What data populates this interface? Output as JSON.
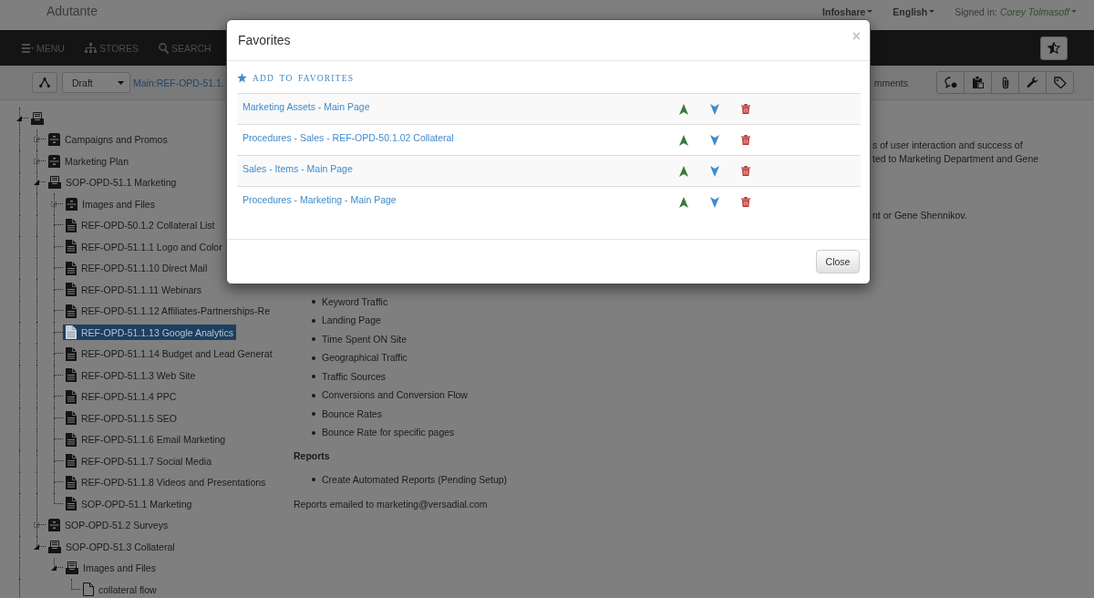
{
  "header": {
    "brand": "Adutante",
    "dropdowns": [
      {
        "label": "Infoshare"
      },
      {
        "label": "English"
      }
    ],
    "signed_in_label": "Signed in:",
    "user_name": "Corey Tolmasoff"
  },
  "navbar": {
    "items": [
      {
        "label": "MENU"
      },
      {
        "label": "STORES"
      },
      {
        "label": "SEARCH"
      }
    ]
  },
  "toolbar": {
    "status_select": "Draft",
    "page_link": "Main:REF-OPD-51.1.",
    "comments_link": "mments"
  },
  "tree": [
    {
      "kind": "folder",
      "expanded": true,
      "selected": false,
      "children": [
        {
          "label": "Campaigns and Promos",
          "kind": "folder",
          "expanded": false,
          "selected": false
        },
        {
          "label": "Marketing Plan",
          "kind": "folder",
          "expanded": false,
          "selected": false
        },
        {
          "label": "SOP-OPD-51.1 Marketing",
          "kind": "folder",
          "expanded": true,
          "selected": false,
          "children": [
            {
              "label": "Images and Files",
              "kind": "folder",
              "expanded": false,
              "selected": false
            },
            {
              "label": "REF-OPD-50.1.2 Collateral List",
              "kind": "page",
              "selected": false
            },
            {
              "label": "REF-OPD-51.1.1 Logo and Color",
              "kind": "page",
              "selected": false
            },
            {
              "label": "REF-OPD-51.1.10 Direct Mail",
              "kind": "page",
              "selected": false
            },
            {
              "label": "REF-OPD-51.1.11 Webinars",
              "kind": "page",
              "selected": false
            },
            {
              "label": "REF-OPD-51.1.12 Affiliates-Partnerships-Re",
              "kind": "page",
              "selected": false
            },
            {
              "label": "REF-OPD-51.1.13 Google Analytics",
              "kind": "page",
              "selected": true
            },
            {
              "label": "REF-OPD-51.1.14 Budget and Lead Generat",
              "kind": "page",
              "selected": false
            },
            {
              "label": "REF-OPD-51.1.3 Web Site",
              "kind": "page",
              "selected": false
            },
            {
              "label": "REF-OPD-51.1.4 PPC",
              "kind": "page",
              "selected": false
            },
            {
              "label": "REF-OPD-51.1.5 SEO",
              "kind": "page",
              "selected": false
            },
            {
              "label": "REF-OPD-51.1.6 Email Marketing",
              "kind": "page",
              "selected": false
            },
            {
              "label": "REF-OPD-51.1.7 Social Media",
              "kind": "page",
              "selected": false
            },
            {
              "label": "REF-OPD-51.1.8 Videos and Presentations",
              "kind": "page",
              "selected": false
            },
            {
              "label": "SOP-OPD-51.1 Marketing",
              "kind": "page",
              "selected": false
            }
          ]
        },
        {
          "label": "SOP-OPD-51.2 Surveys",
          "kind": "folder",
          "expanded": false,
          "selected": false
        },
        {
          "label": "SOP-OPD-51.3 Collateral",
          "kind": "folder",
          "expanded": true,
          "selected": false,
          "children": [
            {
              "label": "Images and Files",
              "kind": "folder",
              "expanded": true,
              "selected": false,
              "children": [
                {
                  "label": "collateral flow",
                  "kind": "file",
                  "selected": false
                }
              ]
            }
          ]
        }
      ]
    }
  ],
  "content": {
    "paragraphs": [
      {
        "lines": [
          "s of user interaction and success of",
          "ted to Marketing Department and Gene"
        ]
      },
      {
        "lines": [
          "nt or Gene Shennikov."
        ]
      }
    ],
    "metrics": [
      "Keyword Traffic",
      "Landing Page",
      "Time Spent ON Site",
      "Geographical Traffic",
      "Traffic Sources",
      "Conversions and Conversion Flow",
      "Bounce Rates",
      "Bounce Rate for specific pages"
    ],
    "reports_heading": "Reports",
    "reports_items": [
      "Create Automated Reports (Pending Setup)"
    ],
    "note": "Reports emailed to marketing@versadial.com"
  },
  "modal": {
    "title": "Favorites",
    "close_symbol": "×",
    "add_link": "ADD TO FAVORITES",
    "favorites": [
      {
        "title": "Marketing Assets - Main Page"
      },
      {
        "title": "Procedures - Sales - REF-OPD-50.1.02 Collateral"
      },
      {
        "title": "Sales - Items - Main Page"
      },
      {
        "title": "Procedures - Marketing - Main Page"
      }
    ],
    "close_button": "Close"
  }
}
